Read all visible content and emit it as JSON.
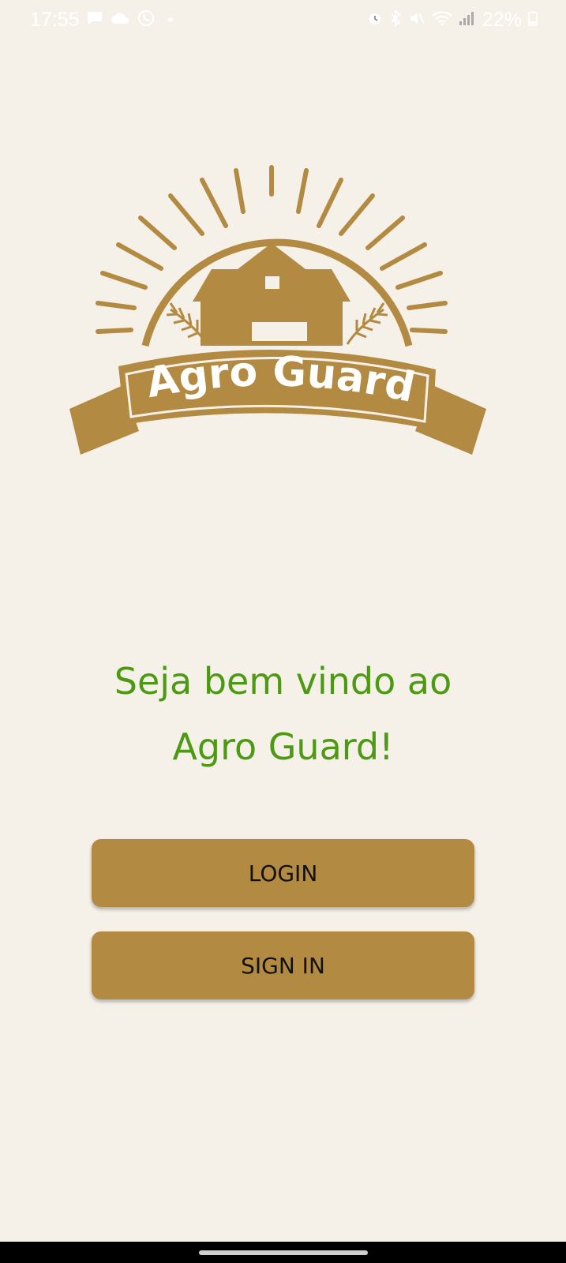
{
  "status_bar": {
    "time": "17:55",
    "battery": "22%",
    "left_icons": [
      "chat-icon",
      "cloud-icon",
      "whatsapp-icon"
    ],
    "right_icons": [
      "alarm-icon",
      "bluetooth-icon",
      "mute-icon",
      "wifi-icon",
      "signal-icon",
      "battery-icon"
    ]
  },
  "logo": {
    "text": "Agro Guard",
    "color": "#b38a41"
  },
  "welcome": {
    "line1": "Seja bem vindo ao",
    "line2": "Agro Guard!",
    "color": "#4c9a12"
  },
  "buttons": {
    "login_label": "LOGIN",
    "signin_label": "SIGN IN",
    "color": "#b38a41"
  },
  "colors": {
    "background": "#f5f0e8"
  }
}
